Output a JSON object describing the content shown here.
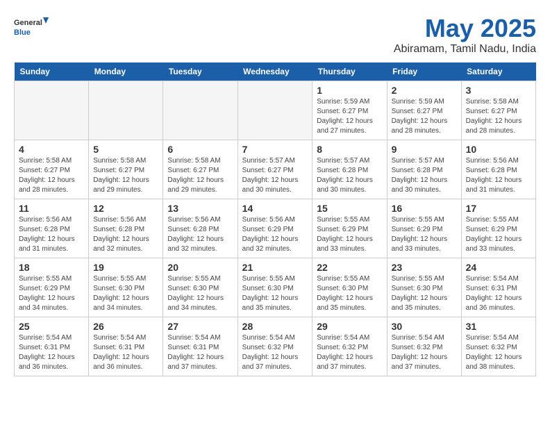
{
  "logo": {
    "text_general": "General",
    "text_blue": "Blue"
  },
  "header": {
    "month_title": "May 2025",
    "location": "Abiramam, Tamil Nadu, India"
  },
  "days_of_week": [
    "Sunday",
    "Monday",
    "Tuesday",
    "Wednesday",
    "Thursday",
    "Friday",
    "Saturday"
  ],
  "weeks": [
    [
      {
        "day": "",
        "detail": ""
      },
      {
        "day": "",
        "detail": ""
      },
      {
        "day": "",
        "detail": ""
      },
      {
        "day": "",
        "detail": ""
      },
      {
        "day": "1",
        "detail": "Sunrise: 5:59 AM\nSunset: 6:27 PM\nDaylight: 12 hours\nand 27 minutes."
      },
      {
        "day": "2",
        "detail": "Sunrise: 5:59 AM\nSunset: 6:27 PM\nDaylight: 12 hours\nand 28 minutes."
      },
      {
        "day": "3",
        "detail": "Sunrise: 5:58 AM\nSunset: 6:27 PM\nDaylight: 12 hours\nand 28 minutes."
      }
    ],
    [
      {
        "day": "4",
        "detail": "Sunrise: 5:58 AM\nSunset: 6:27 PM\nDaylight: 12 hours\nand 28 minutes."
      },
      {
        "day": "5",
        "detail": "Sunrise: 5:58 AM\nSunset: 6:27 PM\nDaylight: 12 hours\nand 29 minutes."
      },
      {
        "day": "6",
        "detail": "Sunrise: 5:58 AM\nSunset: 6:27 PM\nDaylight: 12 hours\nand 29 minutes."
      },
      {
        "day": "7",
        "detail": "Sunrise: 5:57 AM\nSunset: 6:27 PM\nDaylight: 12 hours\nand 30 minutes."
      },
      {
        "day": "8",
        "detail": "Sunrise: 5:57 AM\nSunset: 6:28 PM\nDaylight: 12 hours\nand 30 minutes."
      },
      {
        "day": "9",
        "detail": "Sunrise: 5:57 AM\nSunset: 6:28 PM\nDaylight: 12 hours\nand 30 minutes."
      },
      {
        "day": "10",
        "detail": "Sunrise: 5:56 AM\nSunset: 6:28 PM\nDaylight: 12 hours\nand 31 minutes."
      }
    ],
    [
      {
        "day": "11",
        "detail": "Sunrise: 5:56 AM\nSunset: 6:28 PM\nDaylight: 12 hours\nand 31 minutes."
      },
      {
        "day": "12",
        "detail": "Sunrise: 5:56 AM\nSunset: 6:28 PM\nDaylight: 12 hours\nand 32 minutes."
      },
      {
        "day": "13",
        "detail": "Sunrise: 5:56 AM\nSunset: 6:28 PM\nDaylight: 12 hours\nand 32 minutes."
      },
      {
        "day": "14",
        "detail": "Sunrise: 5:56 AM\nSunset: 6:29 PM\nDaylight: 12 hours\nand 32 minutes."
      },
      {
        "day": "15",
        "detail": "Sunrise: 5:55 AM\nSunset: 6:29 PM\nDaylight: 12 hours\nand 33 minutes."
      },
      {
        "day": "16",
        "detail": "Sunrise: 5:55 AM\nSunset: 6:29 PM\nDaylight: 12 hours\nand 33 minutes."
      },
      {
        "day": "17",
        "detail": "Sunrise: 5:55 AM\nSunset: 6:29 PM\nDaylight: 12 hours\nand 33 minutes."
      }
    ],
    [
      {
        "day": "18",
        "detail": "Sunrise: 5:55 AM\nSunset: 6:29 PM\nDaylight: 12 hours\nand 34 minutes."
      },
      {
        "day": "19",
        "detail": "Sunrise: 5:55 AM\nSunset: 6:30 PM\nDaylight: 12 hours\nand 34 minutes."
      },
      {
        "day": "20",
        "detail": "Sunrise: 5:55 AM\nSunset: 6:30 PM\nDaylight: 12 hours\nand 34 minutes."
      },
      {
        "day": "21",
        "detail": "Sunrise: 5:55 AM\nSunset: 6:30 PM\nDaylight: 12 hours\nand 35 minutes."
      },
      {
        "day": "22",
        "detail": "Sunrise: 5:55 AM\nSunset: 6:30 PM\nDaylight: 12 hours\nand 35 minutes."
      },
      {
        "day": "23",
        "detail": "Sunrise: 5:55 AM\nSunset: 6:30 PM\nDaylight: 12 hours\nand 35 minutes."
      },
      {
        "day": "24",
        "detail": "Sunrise: 5:54 AM\nSunset: 6:31 PM\nDaylight: 12 hours\nand 36 minutes."
      }
    ],
    [
      {
        "day": "25",
        "detail": "Sunrise: 5:54 AM\nSunset: 6:31 PM\nDaylight: 12 hours\nand 36 minutes."
      },
      {
        "day": "26",
        "detail": "Sunrise: 5:54 AM\nSunset: 6:31 PM\nDaylight: 12 hours\nand 36 minutes."
      },
      {
        "day": "27",
        "detail": "Sunrise: 5:54 AM\nSunset: 6:31 PM\nDaylight: 12 hours\nand 37 minutes."
      },
      {
        "day": "28",
        "detail": "Sunrise: 5:54 AM\nSunset: 6:32 PM\nDaylight: 12 hours\nand 37 minutes."
      },
      {
        "day": "29",
        "detail": "Sunrise: 5:54 AM\nSunset: 6:32 PM\nDaylight: 12 hours\nand 37 minutes."
      },
      {
        "day": "30",
        "detail": "Sunrise: 5:54 AM\nSunset: 6:32 PM\nDaylight: 12 hours\nand 37 minutes."
      },
      {
        "day": "31",
        "detail": "Sunrise: 5:54 AM\nSunset: 6:32 PM\nDaylight: 12 hours\nand 38 minutes."
      }
    ]
  ]
}
